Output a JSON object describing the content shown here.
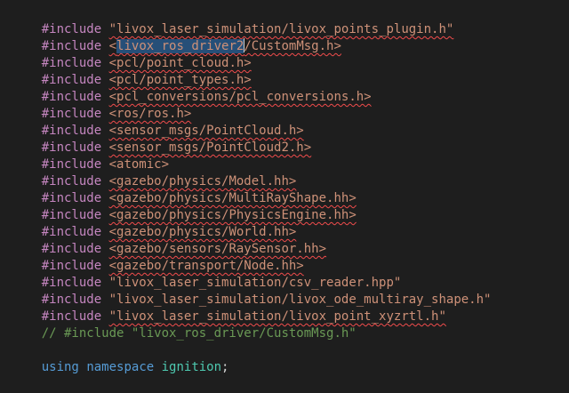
{
  "editor": {
    "lines": [
      {
        "directive": "#include",
        "path": "\"livox_laser_simulation/livox_points_plugin.h\""
      },
      {
        "directive": "#include",
        "sel_open": "<",
        "sel_text": "livox_ros_driver2",
        "after_sel": "/CustomMsg.h>"
      },
      {
        "directive": "#include",
        "path": "<pcl/point_cloud.h>"
      },
      {
        "directive": "#include",
        "path": "<pcl/point_types.h>"
      },
      {
        "directive": "#include",
        "path": "<pcl_conversions/pcl_conversions.h>"
      },
      {
        "directive": "#include",
        "path": "<ros/ros.h>"
      },
      {
        "directive": "#include",
        "path": "<sensor_msgs/PointCloud.h>"
      },
      {
        "directive": "#include",
        "path": "<sensor_msgs/PointCloud2.h>"
      },
      {
        "directive": "#include",
        "path": "<atomic>"
      },
      {
        "directive": "#include",
        "path": "<gazebo/physics/Model.hh>"
      },
      {
        "directive": "#include",
        "path": "<gazebo/physics/MultiRayShape.hh>"
      },
      {
        "directive": "#include",
        "path": "<gazebo/physics/PhysicsEngine.hh>"
      },
      {
        "directive": "#include",
        "path": "<gazebo/physics/World.hh>"
      },
      {
        "directive": "#include",
        "path": "<gazebo/sensors/RaySensor.hh>"
      },
      {
        "directive": "#include",
        "path": "<gazebo/transport/Node.hh>"
      },
      {
        "directive": "#include",
        "path": "\"livox_laser_simulation/csv_reader.hpp\""
      },
      {
        "directive": "#include",
        "path": "\"livox_laser_simulation/livox_ode_multiray_shape.h\""
      },
      {
        "directive": "#include",
        "path": "\"livox_laser_simulation/livox_point_xyzrtl.h\""
      },
      {
        "comment": "// #include \"livox_ros_driver/CustomMsg.h\""
      },
      {
        "blank": ""
      },
      {
        "kw1": "using",
        "kw2": "namespace",
        "ident": "ignition",
        "punct": ";"
      }
    ]
  },
  "colors": {
    "background": "#1e1e1e",
    "directive": "#c586c0",
    "string": "#ce9178",
    "comment": "#6a9955",
    "keyword": "#569cd6",
    "identifier": "#4ec9b0",
    "error_squiggle": "#f14c4c",
    "selection": "#264f78"
  }
}
